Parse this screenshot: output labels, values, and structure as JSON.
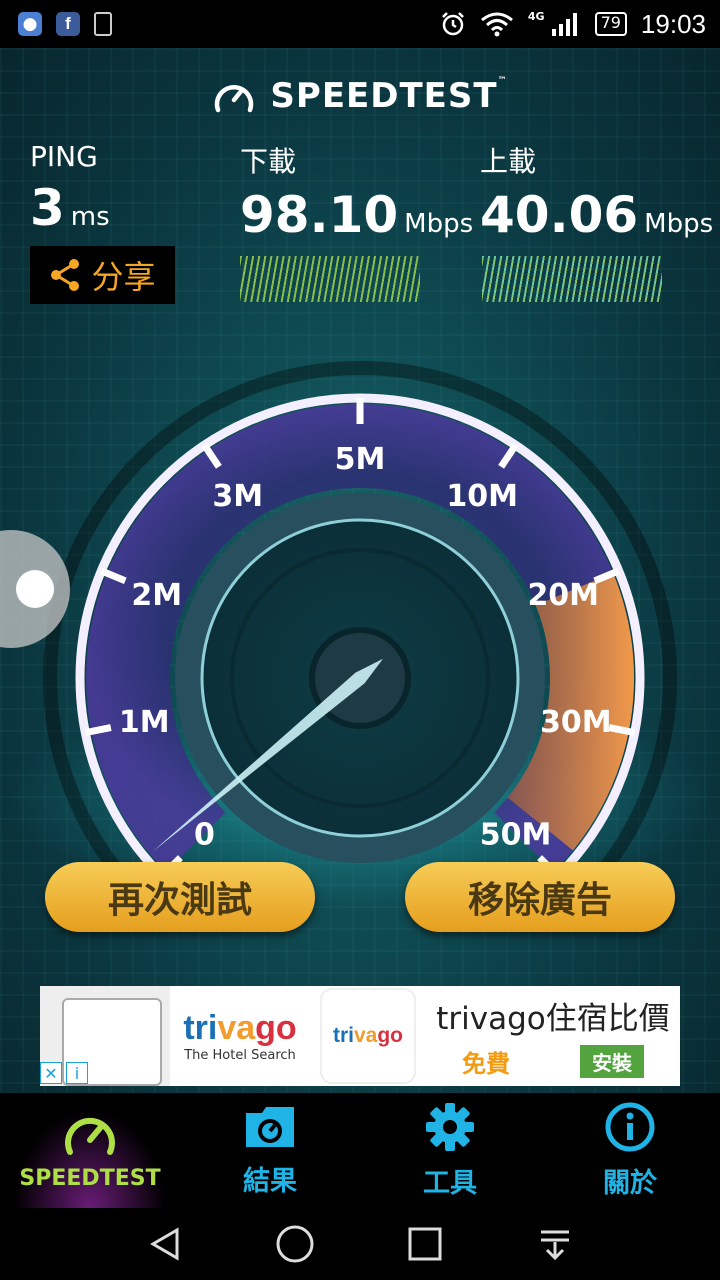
{
  "status_bar": {
    "network": "4G",
    "battery": "79",
    "time": "19:03"
  },
  "app": {
    "title": "SPEEDTEST",
    "trademark": "™"
  },
  "metrics": {
    "ping": {
      "label": "PING",
      "value": "3",
      "unit": "ms"
    },
    "download": {
      "label": "下載",
      "value": "98.10",
      "unit": "Mbps"
    },
    "upload": {
      "label": "上載",
      "value": "40.06",
      "unit": "Mbps"
    }
  },
  "share": {
    "label": "分享"
  },
  "gauge": {
    "ticks": [
      "0",
      "1M",
      "2M",
      "3M",
      "5M",
      "10M",
      "20M",
      "30M",
      "50M"
    ],
    "needle_tick_position": 0.15
  },
  "buttons": {
    "retest": "再次測試",
    "remove_ads": "移除廣告"
  },
  "ad": {
    "brand": "trivago",
    "tagline": "The Hotel Search",
    "title": "trivago住宿比價",
    "free": "免費",
    "install": "安裝",
    "close": "✕",
    "info": "i"
  },
  "tabs": [
    {
      "label": "SPEEDTEST",
      "icon": "speedometer-icon"
    },
    {
      "label": "結果",
      "icon": "folder-icon"
    },
    {
      "label": "工具",
      "icon": "gear-icon"
    },
    {
      "label": "關於",
      "icon": "info-icon"
    }
  ],
  "colors": {
    "accent": "#1fb3e6",
    "active_tab": "#aee046",
    "button": "#f0b43a"
  }
}
